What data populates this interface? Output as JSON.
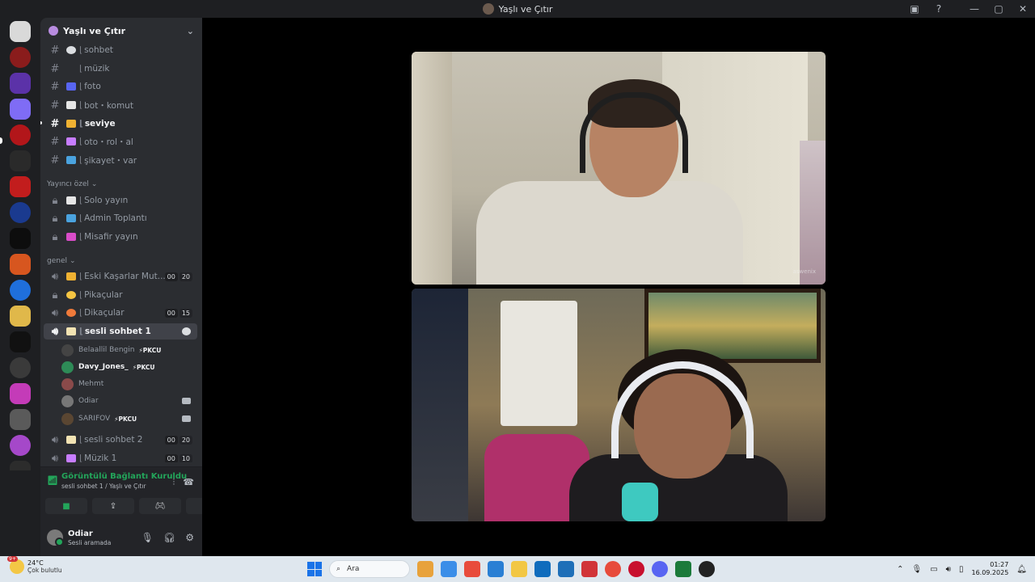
{
  "window": {
    "title": "Yaşlı ve Çıtır",
    "controls": [
      "inbox-icon",
      "help-icon",
      "minimize-icon",
      "maximize-icon",
      "close-icon"
    ]
  },
  "server_rail": {
    "colors": [
      "#d9d9d9",
      "#8a1c1c",
      "#5b32a8",
      "#7f6cf5",
      "#b2161a",
      "#2a2a2a",
      "#c21d1d",
      "#1a3a8f",
      "#0d0d0d",
      "#d7561f",
      "#1f6fdc",
      "#e0b84a",
      "#111111",
      "#3a3a3a",
      "#c43bb8",
      "#5a5a5a",
      "#a548c9",
      "#2c2c2c"
    ]
  },
  "guild": {
    "name": "Yaşlı ve Çıtır"
  },
  "channels": {
    "text": [
      {
        "label": "sohbet",
        "emoji_color": "#dbdee1"
      },
      {
        "label": "müzik",
        "emoji_color": "#2b2d31"
      },
      {
        "label": "foto",
        "emoji_color": "#5865f2"
      },
      {
        "label": "bot・komut",
        "emoji_color": "#e6e6e6"
      },
      {
        "label": "seviye",
        "emoji_color": "#f0b232"
      },
      {
        "label": "oto・rol・al",
        "emoji_color": "#c77dff"
      },
      {
        "label": "şikayet・var",
        "emoji_color": "#4aa3df"
      }
    ],
    "category_streamer": "Yayıncı özel",
    "streamer": [
      {
        "label": "Solo yayın",
        "emoji_color": "#e6e6e6"
      },
      {
        "label": "Admin Toplantı",
        "emoji_color": "#4aa3df"
      },
      {
        "label": "Misafir yayın",
        "emoji_color": "#d94cc8"
      }
    ],
    "category_general": "genel",
    "voice": [
      {
        "label": "Eski Kaşarlar Mut...",
        "emoji_color": "#f0b232",
        "count": "00",
        "limit": "20"
      },
      {
        "label": "Pikaçular",
        "emoji_color": "#f5c542"
      },
      {
        "label": "Dikaçular",
        "emoji_color": "#f07a3a",
        "count": "00",
        "limit": "15"
      },
      {
        "label": "sesli sohbet 1",
        "emoji_color": "#f2e3b3"
      }
    ],
    "voice_users": [
      {
        "name": "Belaallil Bengin",
        "tag": "⚡PKCU",
        "avatar": "#444"
      },
      {
        "name": "Davy_Jones_",
        "tag": "⚡PKCU",
        "avatar": "#2e8b57"
      },
      {
        "name": "Mehmt",
        "avatar": "#8a4a4a"
      },
      {
        "name": "Odiar",
        "avatar": "#777"
      },
      {
        "name": "SARIFOV",
        "tag": "⚡PKCU",
        "avatar": "#5a4632"
      }
    ],
    "voice_more": [
      {
        "label": "sesli sohbet 2",
        "emoji_color": "#f2e3b3",
        "count": "00",
        "limit": "20"
      },
      {
        "label": "Müzik 1",
        "emoji_color": "#c77dff",
        "count": "00",
        "limit": "10"
      }
    ]
  },
  "voice_panel": {
    "status": "Görüntülü Bağlantı Kuruldu",
    "location": "sesli sohbet 1 / Yaşlı ve Çıtır",
    "buttons": [
      "camera-icon",
      "screen-share-icon",
      "activity-icon",
      "soundboard-icon"
    ]
  },
  "user": {
    "name": "Odiar",
    "status": "Sesli aramada"
  },
  "video": {
    "watermark": "aswenix"
  },
  "taskbar": {
    "temp": "24°C",
    "weather": "Çok bulutlu",
    "weather_badge": "9+",
    "search_placeholder": "Ara",
    "time": "01:27",
    "date": "16.09.2025",
    "app_colors": [
      "#e8a23b",
      "#3b8ee8",
      "#e84b3b",
      "#2a7fd4",
      "#f2c744",
      "#0f6cbd",
      "#1e6fb8",
      "#d13438",
      "#e74b3b",
      "#c8102e",
      "#5865f2",
      "#1b7a3a",
      "#222222"
    ]
  }
}
